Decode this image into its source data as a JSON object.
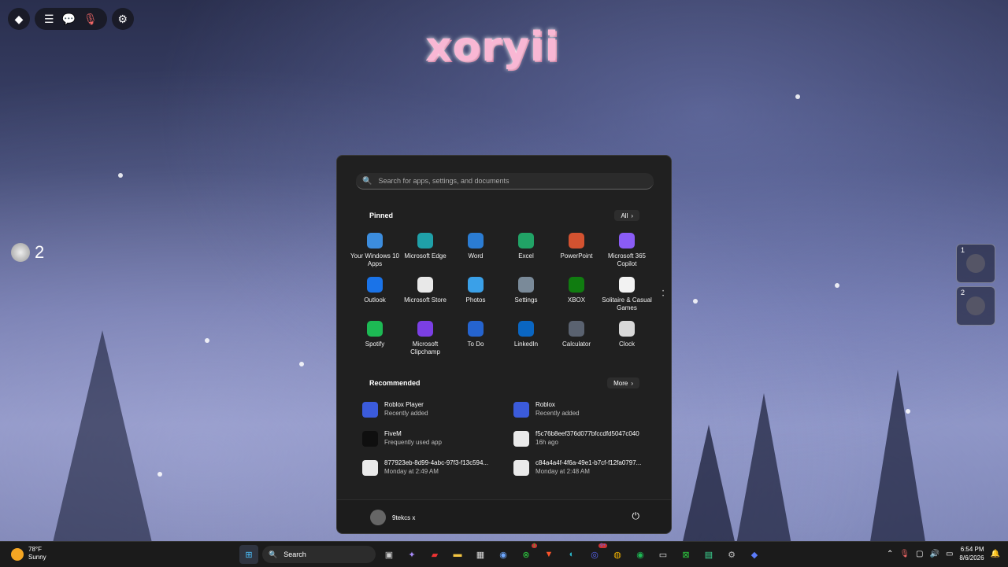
{
  "overlay": {
    "logo": "xoryii",
    "coins_count": "2",
    "hotbar": [
      "1",
      "2"
    ]
  },
  "start_menu": {
    "search_placeholder": "Search for apps, settings, and documents",
    "pinned_title": "Pinned",
    "all_label": "All",
    "pinned": [
      {
        "label": "Your Windows 10 Apps",
        "icon": "windows-apps-icon",
        "color": "#3c8dde"
      },
      {
        "label": "Microsoft Edge",
        "icon": "edge-icon",
        "color": "#1fa0a8"
      },
      {
        "label": "Word",
        "icon": "word-icon",
        "color": "#2b7cd3"
      },
      {
        "label": "Excel",
        "icon": "excel-icon",
        "color": "#21a366"
      },
      {
        "label": "PowerPoint",
        "icon": "powerpoint-icon",
        "color": "#d35230"
      },
      {
        "label": "Microsoft 365 Copilot",
        "icon": "copilot-icon",
        "color": "#8a5cf6"
      },
      {
        "label": "Outlook",
        "icon": "outlook-icon",
        "color": "#1a73e8"
      },
      {
        "label": "Microsoft Store",
        "icon": "store-icon",
        "color": "#e8e8e8"
      },
      {
        "label": "Photos",
        "icon": "photos-icon",
        "color": "#3aa0e8"
      },
      {
        "label": "Settings",
        "icon": "settings-icon",
        "color": "#7a8a99"
      },
      {
        "label": "XBOX",
        "icon": "xbox-icon",
        "color": "#107c10"
      },
      {
        "label": "Solitaire & Casual Games",
        "icon": "solitaire-icon",
        "color": "#f2f2f2"
      },
      {
        "label": "Spotify",
        "icon": "spotify-icon",
        "color": "#1db954"
      },
      {
        "label": "Microsoft Clipchamp",
        "icon": "clipchamp-icon",
        "color": "#7b3fe4"
      },
      {
        "label": "To Do",
        "icon": "todo-icon",
        "color": "#2564cf"
      },
      {
        "label": "LinkedIn",
        "icon": "linkedin-icon",
        "color": "#0a66c2"
      },
      {
        "label": "Calculator",
        "icon": "calculator-icon",
        "color": "#5a6270"
      },
      {
        "label": "Clock",
        "icon": "clock-icon",
        "color": "#d8d8d8"
      }
    ],
    "recommended_title": "Recommended",
    "more_label": "More",
    "recommended": [
      {
        "name": "Roblox Player",
        "sub": "Recently added",
        "icon": "roblox-icon",
        "color": "#3b5bdb"
      },
      {
        "name": "Roblox",
        "sub": "Recently added",
        "icon": "roblox-icon",
        "color": "#3b5bdb"
      },
      {
        "name": "FiveM",
        "sub": "Frequently used app",
        "icon": "fivem-icon",
        "color": "#0f0f0f"
      },
      {
        "name": "f5c76b8eef376d077bfccdfd5047c040",
        "sub": "16h ago",
        "icon": "image-file-icon",
        "color": "#eaeaea"
      },
      {
        "name": "877923eb-8d99-4abc-97f3-f13c594...",
        "sub": "Monday at 2:49 AM",
        "icon": "image-file-icon",
        "color": "#eaeaea"
      },
      {
        "name": "c84a4a4f-4f6a-49e1-b7cf-f12fa0797...",
        "sub": "Monday at 2:48 AM",
        "icon": "image-file-icon",
        "color": "#eaeaea"
      }
    ],
    "user_name": "9tekcs x"
  },
  "taskbar": {
    "weather_temp": "78°F",
    "weather_desc": "Sunny",
    "search_label": "Search",
    "time": "6:54 PM",
    "date": "8/6/2026",
    "badges": {
      "xbox": "1",
      "discord": "9+"
    }
  }
}
